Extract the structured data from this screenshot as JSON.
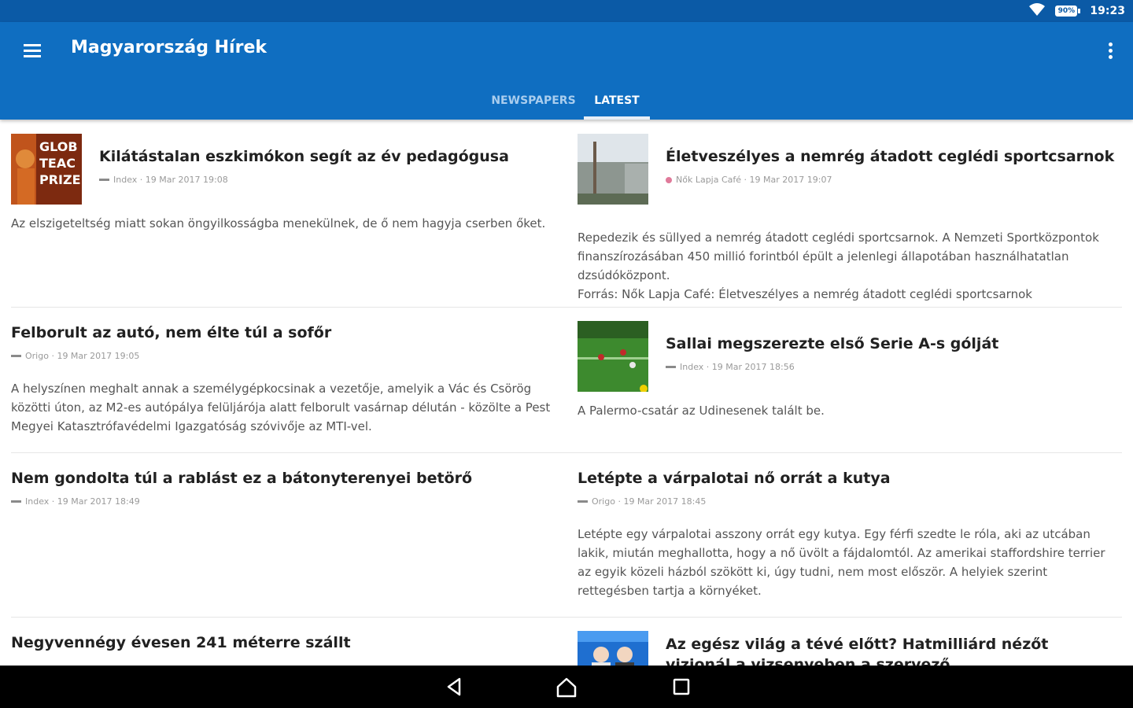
{
  "status": {
    "battery": "90%",
    "time": "19:23"
  },
  "header": {
    "title": "Magyarország Hírek"
  },
  "tabs": [
    {
      "label": "NEWSPAPERS"
    },
    {
      "label": "LATEST"
    }
  ],
  "articles": [
    {
      "title": "Kilátástalan eszkimókon segít az év pedagógusa",
      "meta": "Index · 19 Mar 2017 19:08",
      "description": "Az elszigeteltség miatt sokan öngyilkosságba menekülnek, de ő nem hagyja cserben őket.",
      "thumb_text": "GLOB TEAC PRIZE"
    },
    {
      "title": "Életveszélyes a nemrég átadott ceglédi sportcsarnok",
      "meta": "Nők Lapja Café · 19 Mar 2017 19:07",
      "description": "Repedezik és süllyed a nemrég átadott ceglédi sportcsarnok. A Nemzeti Sportközpontok finanszírozásában 450 millió forintból épült a jelenlegi állapotában használhatatlan dzsúdóközpont.",
      "description2": "Forrás: Nők Lapja Café: Életveszélyes a nemrég átadott ceglédi sportcsarnok"
    },
    {
      "title": "Felborult az autó, nem élte túl a sofőr",
      "meta": "Origo · 19 Mar 2017 19:05",
      "description": "A helyszínen meghalt annak a személygépkocsinak a vezetője, amelyik a Vác és Csörög közötti úton, az M2-es autópálya felüljárója alatt felborult vasárnap délután - közölte a Pest Megyei Katasztrófavédelmi Igazgatóság szóvivője az MTI-vel."
    },
    {
      "title": "Sallai megszerezte első Serie A-s gólját",
      "meta": "Index · 19 Mar 2017 18:56",
      "description": "A Palermo-csatár az Udinesenek talált be."
    },
    {
      "title": "Nem gondolta túl a rablást ez a bátonyterenyei betörő",
      "meta": "Index · 19 Mar 2017 18:49",
      "description": ""
    },
    {
      "title": "Letépte a várpalotai nő orrát a kutya",
      "meta": "Origo · 19 Mar 2017 18:45",
      "description": "Letépte egy várpalotai asszony orrát egy kutya. Egy férfi szedte le róla, aki az utcában lakik, miután meghallotta, hogy a nő üvölt a fájdalomtól. Az amerikai staffordshire terrier az egyik közeli házból szökött ki, úgy tudni, nem most először. A helyiek szerint rettegésben tartja a környéket."
    },
    {
      "title": "Negyvennégy évesen 241 méterre szállt",
      "meta": ""
    },
    {
      "title": "Az egész világ a tévé előtt? Hatmilliárd nézőt vizionál a vizsenyeben a szervező",
      "title_line2": "vizsenyeben a szervező",
      "meta": ""
    }
  ]
}
